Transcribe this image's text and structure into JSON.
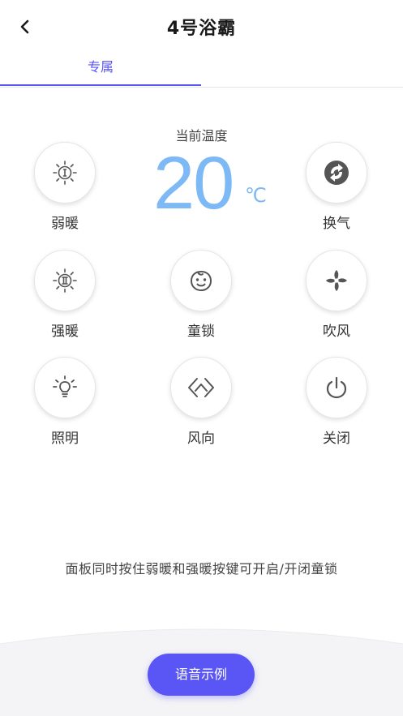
{
  "header": {
    "title": "4号浴霸",
    "back_icon": "chevron-left-icon"
  },
  "tabs": [
    {
      "label": "专属",
      "active": true
    }
  ],
  "temperature": {
    "label": "当前温度",
    "value": "20",
    "unit": "℃"
  },
  "controls": [
    {
      "label": "弱暖",
      "icon": "sun-one-icon"
    },
    {
      "label": "换气",
      "icon": "exchange-icon"
    },
    {
      "label": "强暖",
      "icon": "sun-two-icon"
    },
    {
      "label": "童锁",
      "icon": "baby-face-icon"
    },
    {
      "label": "吹风",
      "icon": "fan-icon"
    },
    {
      "label": "照明",
      "icon": "bulb-icon"
    },
    {
      "label": "风向",
      "icon": "wind-direction-icon"
    },
    {
      "label": "关闭",
      "icon": "power-icon"
    }
  ],
  "hint": "面板同时按住弱暖和强暖按键可开启/开闭童锁",
  "voice_button": {
    "label": "语音示例"
  },
  "colors": {
    "accent": "#5855f2",
    "temperature": "#7cb9f5",
    "icon": "#555555"
  }
}
